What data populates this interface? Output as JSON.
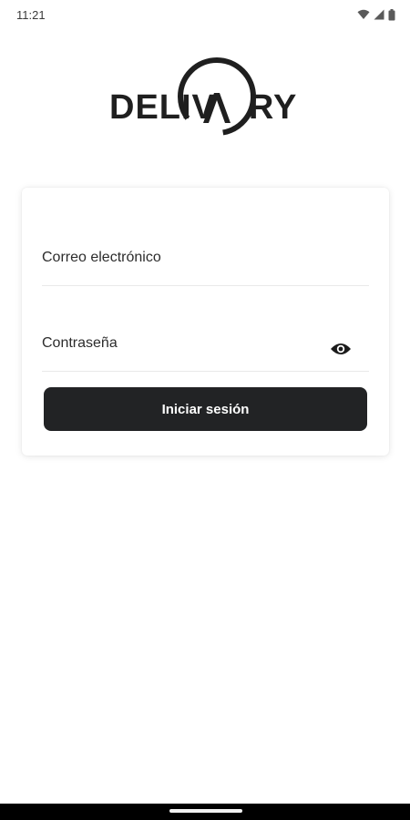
{
  "status_bar": {
    "time": "11:21",
    "icons": [
      "wifi-icon",
      "signal-icon",
      "battery-icon"
    ]
  },
  "logo": {
    "left_text": "DELIV",
    "right_text": "RY",
    "full_text": "DELIVARY"
  },
  "login_form": {
    "email_label": "Correo electrónico",
    "password_label": "Contraseña",
    "password_toggle_icon": "eye-icon",
    "submit_label": "Iniciar sesión"
  },
  "colors": {
    "button_background": "#222325",
    "button_text": "#ffffff",
    "field_divider": "#e9e9e9"
  }
}
